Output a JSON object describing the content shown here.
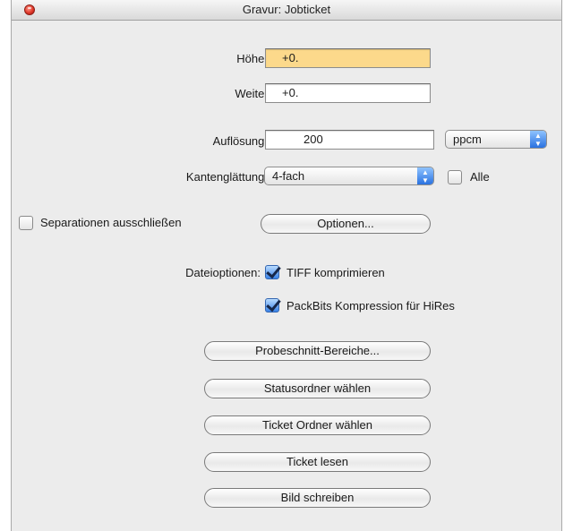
{
  "window": {
    "title": "Gravur: Jobticket"
  },
  "fields": {
    "hoehe": {
      "label": "Höhe:",
      "value": "+0."
    },
    "weite": {
      "label": "Weite:",
      "value": "+0."
    },
    "aufloesung": {
      "label": "Auflösung:",
      "value": "200",
      "unit": "ppcm"
    }
  },
  "kantenglaettung": {
    "label": "Kantenglättung:",
    "value": "4-fach",
    "alle_label": "Alle",
    "alle_checked": false
  },
  "separationen": {
    "label": "Separationen ausschließen",
    "checked": false,
    "options_button": "Optionen..."
  },
  "dateioptionen": {
    "label": "Dateioptionen:",
    "tiff_label": "TIFF komprimieren",
    "tiff_checked": true,
    "packbits_label": "PackBits Kompression für HiRes",
    "packbits_checked": true
  },
  "buttons": {
    "probeschnitt": "Probeschnitt-Bereiche...",
    "statusordner": "Statusordner wählen",
    "ticketordner": "Ticket Ordner wählen",
    "ticketlesen": "Ticket lesen",
    "bildschreiben": "Bild schreiben"
  },
  "colors": {
    "focus_field": "#fcd98b",
    "accent": "#3a83e8",
    "close": "#e0382a"
  }
}
